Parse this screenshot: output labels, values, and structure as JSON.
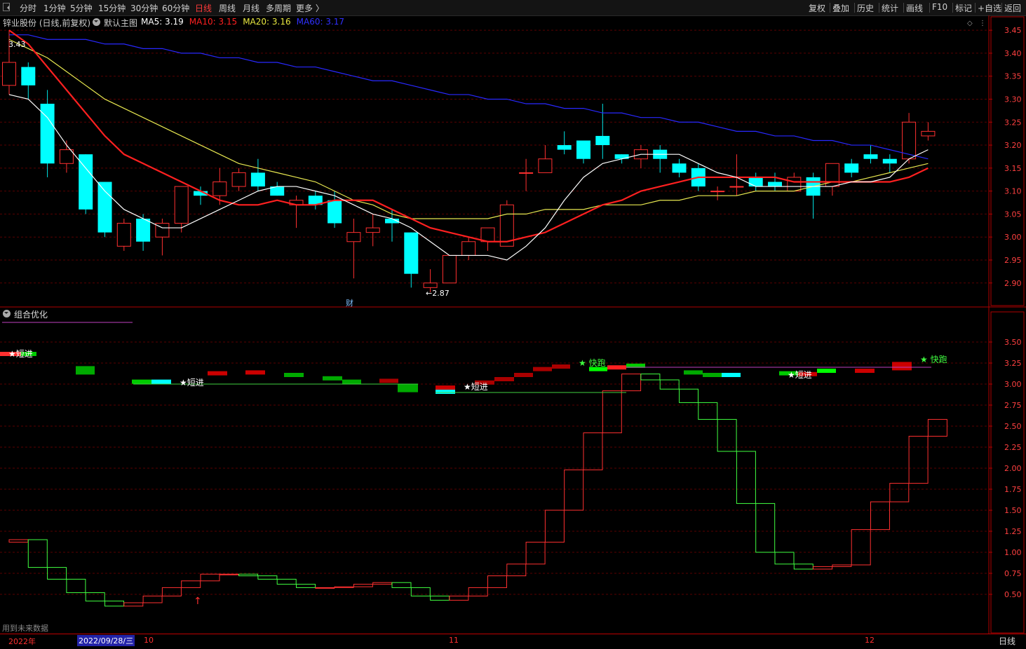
{
  "toolbar": {
    "periods": [
      "分时",
      "1分钟",
      "5分钟",
      "15分钟",
      "30分钟",
      "60分钟",
      "日线",
      "周线",
      "月线",
      "多周期",
      "更多 〉"
    ],
    "active_period": "日线",
    "right_buttons": [
      "复权",
      "叠加",
      "历史",
      "统计",
      "画线",
      "F10",
      "标记",
      "+自选",
      "返回"
    ]
  },
  "main_chart": {
    "stock_name": "锌业股份",
    "mode": "(日线,前复权)",
    "template": "默认主图",
    "ma": [
      {
        "label": "MA5: 3.19",
        "color": "#ffffff"
      },
      {
        "label": "MA10: 3.15",
        "color": "#ff2020"
      },
      {
        "label": "MA20: 3.16",
        "color": "#e8e840"
      },
      {
        "label": "MA60: 3.17",
        "color": "#3030ff"
      }
    ],
    "high_marker": "3.43",
    "low_marker": "←2.87",
    "event_marker": "财",
    "y_ticks": [
      "3.45",
      "3.40",
      "3.35",
      "3.30",
      "3.25",
      "3.20",
      "3.15",
      "3.10",
      "3.05",
      "3.00",
      "2.95",
      "2.90"
    ]
  },
  "indicator": {
    "name": "组合优化",
    "y_ticks": [
      "3.50",
      "3.25",
      "3.00",
      "2.75",
      "2.50",
      "2.25",
      "2.00",
      "1.75",
      "1.50",
      "1.25",
      "1.00",
      "0.75",
      "0.50"
    ],
    "signals": [
      "★短进",
      "★短进",
      "★短进",
      "★ 快跑",
      "★短进",
      "★ 快跑"
    ],
    "footnote": "用到未来数据"
  },
  "footer": {
    "year": "2022年",
    "cursor_date": "2022/09/28/三",
    "months": [
      "10",
      "11",
      "12"
    ],
    "period_label": "日线"
  },
  "chart_data": {
    "type": "candlestick",
    "candles": [
      {
        "o": 3.33,
        "h": 3.45,
        "l": 3.31,
        "c": 3.38
      },
      {
        "o": 3.37,
        "h": 3.38,
        "l": 3.3,
        "c": 3.33
      },
      {
        "o": 3.29,
        "h": 3.32,
        "l": 3.13,
        "c": 3.16
      },
      {
        "o": 3.16,
        "h": 3.21,
        "l": 3.14,
        "c": 3.19
      },
      {
        "o": 3.18,
        "h": 3.18,
        "l": 3.05,
        "c": 3.06
      },
      {
        "o": 3.12,
        "h": 3.12,
        "l": 3.0,
        "c": 3.01
      },
      {
        "o": 2.98,
        "h": 3.04,
        "l": 2.97,
        "c": 3.03
      },
      {
        "o": 3.04,
        "h": 3.05,
        "l": 2.97,
        "c": 2.99
      },
      {
        "o": 3.0,
        "h": 3.04,
        "l": 2.96,
        "c": 3.03
      },
      {
        "o": 3.03,
        "h": 3.11,
        "l": 3.01,
        "c": 3.11
      },
      {
        "o": 3.1,
        "h": 3.11,
        "l": 3.07,
        "c": 3.09
      },
      {
        "o": 3.09,
        "h": 3.15,
        "l": 3.07,
        "c": 3.12
      },
      {
        "o": 3.11,
        "h": 3.15,
        "l": 3.1,
        "c": 3.14
      },
      {
        "o": 3.14,
        "h": 3.17,
        "l": 3.1,
        "c": 3.11
      },
      {
        "o": 3.11,
        "h": 3.12,
        "l": 3.09,
        "c": 3.09
      },
      {
        "o": 3.07,
        "h": 3.09,
        "l": 3.02,
        "c": 3.08
      },
      {
        "o": 3.09,
        "h": 3.1,
        "l": 3.06,
        "c": 3.07
      },
      {
        "o": 3.08,
        "h": 3.1,
        "l": 3.02,
        "c": 3.03
      },
      {
        "o": 2.99,
        "h": 3.04,
        "l": 2.91,
        "c": 3.01
      },
      {
        "o": 3.01,
        "h": 3.05,
        "l": 2.98,
        "c": 3.02
      },
      {
        "o": 3.04,
        "h": 3.06,
        "l": 2.99,
        "c": 3.03
      },
      {
        "o": 3.01,
        "h": 3.01,
        "l": 2.89,
        "c": 2.92
      },
      {
        "o": 2.89,
        "h": 2.93,
        "l": 2.88,
        "c": 2.9
      },
      {
        "o": 2.9,
        "h": 2.96,
        "l": 2.9,
        "c": 2.96
      },
      {
        "o": 2.96,
        "h": 3.0,
        "l": 2.95,
        "c": 2.99
      },
      {
        "o": 2.99,
        "h": 3.02,
        "l": 2.97,
        "c": 3.02
      },
      {
        "o": 2.98,
        "h": 3.08,
        "l": 2.98,
        "c": 3.07
      },
      {
        "o": 3.14,
        "h": 3.17,
        "l": 3.1,
        "c": 3.14
      },
      {
        "o": 3.14,
        "h": 3.2,
        "l": 3.14,
        "c": 3.17
      },
      {
        "o": 3.2,
        "h": 3.23,
        "l": 3.18,
        "c": 3.19
      },
      {
        "o": 3.21,
        "h": 3.21,
        "l": 3.16,
        "c": 3.17
      },
      {
        "o": 3.22,
        "h": 3.29,
        "l": 3.17,
        "c": 3.2
      },
      {
        "o": 3.18,
        "h": 3.18,
        "l": 3.16,
        "c": 3.17
      },
      {
        "o": 3.17,
        "h": 3.2,
        "l": 3.15,
        "c": 3.19
      },
      {
        "o": 3.19,
        "h": 3.2,
        "l": 3.14,
        "c": 3.17
      },
      {
        "o": 3.16,
        "h": 3.17,
        "l": 3.13,
        "c": 3.14
      },
      {
        "o": 3.15,
        "h": 3.16,
        "l": 3.1,
        "c": 3.11
      },
      {
        "o": 3.1,
        "h": 3.11,
        "l": 3.08,
        "c": 3.1
      },
      {
        "o": 3.11,
        "h": 3.18,
        "l": 3.09,
        "c": 3.11
      },
      {
        "o": 3.13,
        "h": 3.14,
        "l": 3.1,
        "c": 3.11
      },
      {
        "o": 3.12,
        "h": 3.14,
        "l": 3.1,
        "c": 3.11
      },
      {
        "o": 3.1,
        "h": 3.14,
        "l": 3.1,
        "c": 3.13
      },
      {
        "o": 3.13,
        "h": 3.14,
        "l": 3.04,
        "c": 3.09
      },
      {
        "o": 3.11,
        "h": 3.16,
        "l": 3.09,
        "c": 3.16
      },
      {
        "o": 3.16,
        "h": 3.17,
        "l": 3.13,
        "c": 3.14
      },
      {
        "o": 3.18,
        "h": 3.2,
        "l": 3.16,
        "c": 3.17
      },
      {
        "o": 3.17,
        "h": 3.18,
        "l": 3.14,
        "c": 3.16
      },
      {
        "o": 3.17,
        "h": 3.27,
        "l": 3.16,
        "c": 3.25
      },
      {
        "o": 3.22,
        "h": 3.25,
        "l": 3.21,
        "c": 3.23
      }
    ],
    "ma5": [
      3.31,
      3.3,
      3.26,
      3.2,
      3.15,
      3.1,
      3.06,
      3.04,
      3.02,
      3.02,
      3.04,
      3.06,
      3.08,
      3.1,
      3.11,
      3.11,
      3.1,
      3.09,
      3.07,
      3.05,
      3.04,
      3.02,
      2.99,
      2.96,
      2.96,
      2.96,
      2.95,
      2.98,
      3.02,
      3.08,
      3.13,
      3.16,
      3.17,
      3.18,
      3.18,
      3.18,
      3.16,
      3.14,
      3.13,
      3.11,
      3.11,
      3.11,
      3.11,
      3.11,
      3.12,
      3.12,
      3.13,
      3.17,
      3.19
    ],
    "ma10": [
      3.45,
      3.42,
      3.37,
      3.32,
      3.27,
      3.22,
      3.18,
      3.16,
      3.14,
      3.12,
      3.1,
      3.08,
      3.07,
      3.07,
      3.08,
      3.07,
      3.07,
      3.08,
      3.08,
      3.08,
      3.06,
      3.04,
      3.02,
      3.01,
      3.0,
      2.99,
      2.99,
      3.0,
      3.01,
      3.03,
      3.05,
      3.07,
      3.08,
      3.1,
      3.11,
      3.12,
      3.13,
      3.13,
      3.13,
      3.13,
      3.13,
      3.12,
      3.12,
      3.12,
      3.12,
      3.12,
      3.12,
      3.13,
      3.15
    ],
    "ma20": [
      3.43,
      3.41,
      3.39,
      3.36,
      3.33,
      3.3,
      3.28,
      3.26,
      3.24,
      3.22,
      3.2,
      3.18,
      3.16,
      3.15,
      3.14,
      3.13,
      3.12,
      3.1,
      3.08,
      3.07,
      3.05,
      3.04,
      3.04,
      3.04,
      3.04,
      3.04,
      3.05,
      3.05,
      3.06,
      3.06,
      3.06,
      3.07,
      3.07,
      3.07,
      3.08,
      3.08,
      3.09,
      3.09,
      3.09,
      3.1,
      3.1,
      3.1,
      3.11,
      3.12,
      3.12,
      3.13,
      3.14,
      3.15,
      3.16
    ],
    "ma60": [
      3.44,
      3.44,
      3.43,
      3.43,
      3.43,
      3.42,
      3.42,
      3.41,
      3.41,
      3.4,
      3.4,
      3.39,
      3.39,
      3.38,
      3.38,
      3.37,
      3.37,
      3.36,
      3.35,
      3.34,
      3.34,
      3.33,
      3.32,
      3.31,
      3.31,
      3.3,
      3.3,
      3.29,
      3.29,
      3.28,
      3.28,
      3.27,
      3.27,
      3.26,
      3.26,
      3.25,
      3.25,
      3.24,
      3.23,
      3.23,
      3.22,
      3.22,
      3.21,
      3.21,
      3.2,
      3.2,
      3.19,
      3.18,
      3.17
    ],
    "indicator_step": [
      1.12,
      1.15,
      0.82,
      0.68,
      0.52,
      0.42,
      0.36,
      0.4,
      0.48,
      0.58,
      0.66,
      0.74,
      0.74,
      0.72,
      0.68,
      0.62,
      0.58,
      0.58,
      0.59,
      0.62,
      0.64,
      0.58,
      0.48,
      0.43,
      0.48,
      0.58,
      0.72,
      0.86,
      1.12,
      1.5,
      1.98,
      2.42,
      2.92,
      3.12,
      3.05,
      2.94,
      2.78,
      2.58,
      2.2,
      1.58,
      1.0,
      0.86,
      0.8,
      0.83,
      0.85,
      1.27,
      1.6,
      1.82,
      2.38,
      2.58
    ],
    "ylim": [
      2.86,
      3.47
    ],
    "indicator_ylim": [
      0.3,
      3.65
    ]
  }
}
